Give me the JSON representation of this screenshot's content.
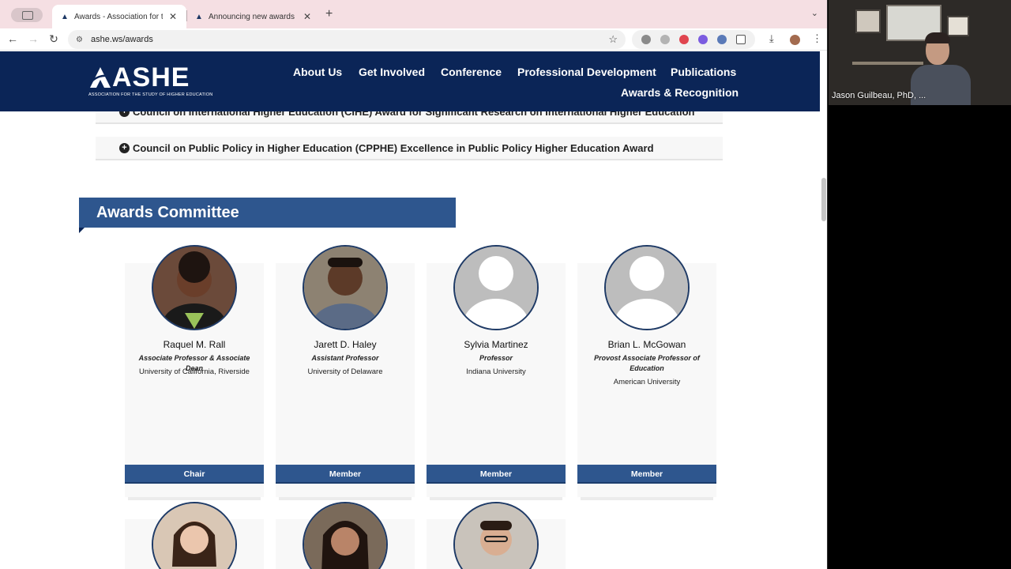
{
  "browser": {
    "tabs": [
      {
        "title": "Awards - Association for the",
        "active": true
      },
      {
        "title": "Announcing new awards and",
        "active": false
      }
    ],
    "url": "ashe.ws/awards"
  },
  "site": {
    "logo_word": "ASHE",
    "logo_sub": "ASSOCIATION FOR THE STUDY OF HIGHER EDUCATION",
    "nav": [
      "About Us",
      "Get Involved",
      "Conference",
      "Professional Development",
      "Publications",
      "Awards & Recognition"
    ]
  },
  "accordions": [
    "Council on International Higher Education (CIHE) Award for Significant Research on International Higher Education",
    "Council on Public Policy in Higher Education (CPPHE) Excellence in Public Policy Higher Education Award"
  ],
  "committee": {
    "heading": "Awards Committee",
    "members": [
      {
        "name": "Raquel M. Rall",
        "title": "Associate Professor & Associate Dean",
        "org": "University of California, Riverside",
        "role": "Chair"
      },
      {
        "name": "Jarett D. Haley",
        "title": "Assistant Professor",
        "org": "University of Delaware",
        "role": "Member"
      },
      {
        "name": "Sylvia Martinez",
        "title": "Professor",
        "org": "Indiana University",
        "role": "Member"
      },
      {
        "name": "Brian L. McGowan",
        "title": "Provost Associate Professor of Education",
        "org": "American University",
        "role": "Member"
      }
    ]
  },
  "video": {
    "participant_name": "Jason Guilbeau, PhD, ..."
  },
  "colors": {
    "header_navy": "#0b2557",
    "accent_blue": "#2e568e",
    "tabstrip_pink": "#f5dfe3"
  }
}
